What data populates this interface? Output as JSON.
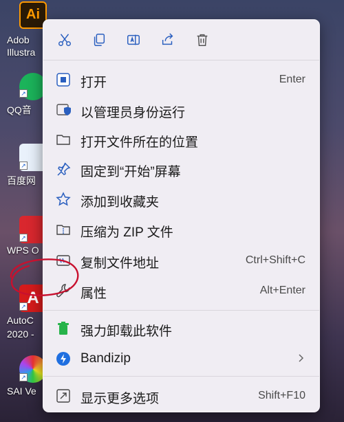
{
  "desktop": {
    "icons": [
      {
        "label": "Adob",
        "label2": "Illustra",
        "color": "#2a1a06",
        "glyph": "Ai",
        "glyph_color": "#ff9a00"
      },
      {
        "label": "QQ音",
        "color": "#1bb35a"
      },
      {
        "label": "百度网",
        "color": "#e9f1fb"
      },
      {
        "label": "WPS O",
        "color": "#d9272e"
      },
      {
        "label": "AutoC",
        "label2": "2020 -",
        "color": "#d51b1b",
        "glyph": "A"
      },
      {
        "label": "SAI Ve",
        "color": "#f1f1f1"
      }
    ]
  },
  "context_menu": {
    "toolbar": [
      {
        "name": "cut",
        "icon": "scissors-icon"
      },
      {
        "name": "copy",
        "icon": "copy-icon"
      },
      {
        "name": "rename",
        "icon": "rename-icon"
      },
      {
        "name": "share",
        "icon": "share-icon"
      },
      {
        "name": "delete",
        "icon": "trash-icon"
      }
    ],
    "items": [
      {
        "label": "打开",
        "shortcut": "Enter",
        "icon": "open-app-icon"
      },
      {
        "label": "以管理员身份运行",
        "shortcut": "",
        "icon": "shield-icon"
      },
      {
        "label": "打开文件所在的位置",
        "shortcut": "",
        "icon": "folder-icon"
      },
      {
        "label": "固定到“开始”屏幕",
        "shortcut": "",
        "icon": "pin-icon"
      },
      {
        "label": "添加到收藏夹",
        "shortcut": "",
        "icon": "star-icon"
      },
      {
        "label": "压缩为 ZIP 文件",
        "shortcut": "",
        "icon": "zip-folder-icon"
      },
      {
        "label": "复制文件地址",
        "shortcut": "Ctrl+Shift+C",
        "icon": "copy-path-icon"
      },
      {
        "label": "属性",
        "shortcut": "Alt+Enter",
        "icon": "wrench-icon"
      },
      {
        "label": "强力卸载此软件",
        "shortcut": "",
        "icon": "green-trash-icon"
      },
      {
        "label": "Bandizip",
        "shortcut": "",
        "icon": "bandizip-icon",
        "has_submenu": true
      },
      {
        "label": "显示更多选项",
        "shortcut": "Shift+F10",
        "icon": "more-options-icon"
      }
    ],
    "highlight_color": "#c8102e"
  }
}
